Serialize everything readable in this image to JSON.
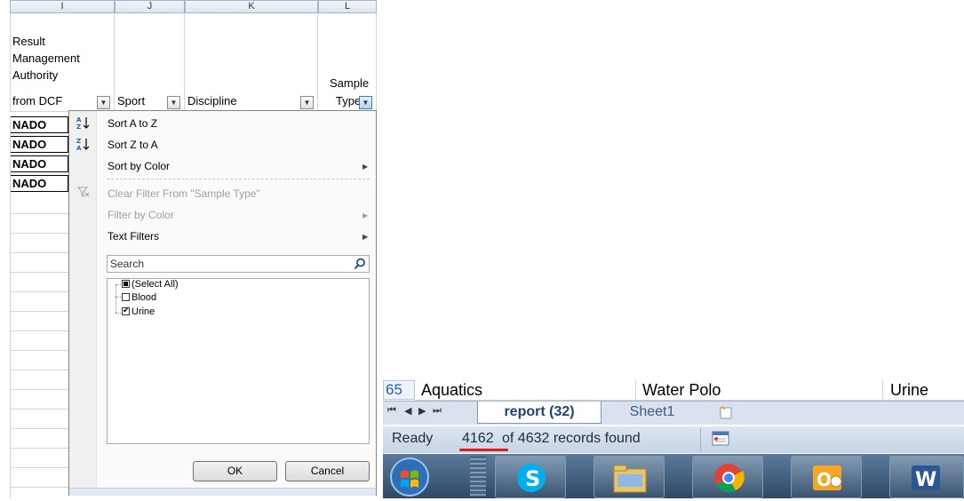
{
  "columns": [
    {
      "letter": "I"
    },
    {
      "letter": "J"
    },
    {
      "letter": "K"
    },
    {
      "letter": "L"
    }
  ],
  "headers": {
    "i_line1": "Result",
    "i_line2": "Management",
    "i_line3": "Authority",
    "i_line4": "from DCF",
    "j": "Sport",
    "k": "Discipline",
    "l_line1": "Sample",
    "l_line2": "Type"
  },
  "cells": [
    "NADO",
    "NADO",
    "NADO",
    "NADO"
  ],
  "menu": {
    "sort_az": "Sort A to Z",
    "sort_za": "Sort Z to A",
    "sort_color": "Sort by Color",
    "clear_filter": "Clear Filter From \"Sample Type\"",
    "filter_color": "Filter by Color",
    "text_filters": "Text Filters",
    "search_placeholder": "Search",
    "items": [
      {
        "label": "(Select All)",
        "state": "partial"
      },
      {
        "label": "Blood",
        "state": "unchecked"
      },
      {
        "label": "Urine",
        "state": "checked"
      }
    ],
    "ok": "OK",
    "cancel": "Cancel"
  },
  "row": {
    "number": "65",
    "sport": "Aquatics",
    "discipline": "Water Polo",
    "sample_type": "Urine"
  },
  "sheet_tabs": {
    "active": "report (32)",
    "other": "Sheet1"
  },
  "status": {
    "ready": "Ready",
    "count": "4162",
    "rest": "of 4632 records found"
  },
  "taskbar": {
    "apps": [
      "start-orb",
      "skype",
      "file-explorer",
      "chrome",
      "outlook",
      "word"
    ]
  },
  "colors": {
    "accent_underline": "#d71f1f",
    "header_blue": "#dde5ef",
    "taskbar": "#2e4966"
  }
}
